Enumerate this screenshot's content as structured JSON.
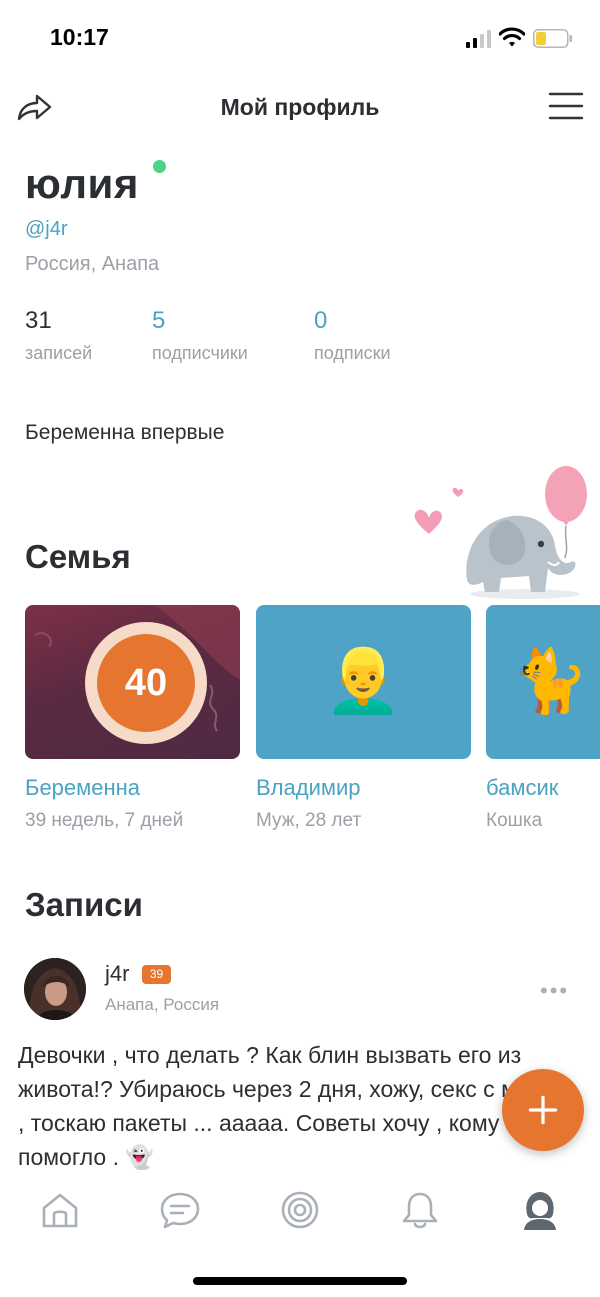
{
  "status_bar": {
    "time": "10:17"
  },
  "nav": {
    "title": "Мой профиль"
  },
  "profile": {
    "name": "юлия",
    "handle": "@j4r",
    "location": "Россия, Анапа",
    "stats": [
      {
        "value": "31",
        "label": "записей"
      },
      {
        "value": "5",
        "label": "подписчики"
      },
      {
        "value": "0",
        "label": "подписки"
      }
    ],
    "bio": "Беременна впервые"
  },
  "family": {
    "title": "Семья",
    "cards": [
      {
        "name": "Беременна",
        "subtitle": "39 недель, 7 дней",
        "week": "40"
      },
      {
        "name": "Владимир",
        "subtitle": "Муж, 28 лет",
        "emoji": "👱‍♂️"
      },
      {
        "name": "бамсик",
        "subtitle": "Кошка",
        "emoji": "🐈"
      }
    ]
  },
  "posts": {
    "title": "Записи",
    "items": [
      {
        "author": "j4r",
        "badge": "39",
        "location": "Анапа, Россия",
        "more": "•••",
        "text": "Девочки , что делать ? Как блин вызвать его из живота!? Убираюсь через 2 дня, хожу, секс с мужем , тоскаю пакеты ... ааааа. Советы хочу , кому что помогло . 👻"
      }
    ]
  },
  "icons": {
    "share": "share-icon",
    "menu": "hamburger-menu-icon",
    "fab": "plus-icon",
    "tabs": [
      "home-icon",
      "chat-icon",
      "target-icon",
      "bell-icon",
      "profile-icon"
    ]
  },
  "colors": {
    "accent_blue": "#4aa3c1",
    "accent_orange": "#e6752f",
    "online_green": "#4bd38c",
    "text_dark": "#2b2f33",
    "text_muted": "#9aa0a6",
    "card_blue": "#4ea3c6"
  }
}
